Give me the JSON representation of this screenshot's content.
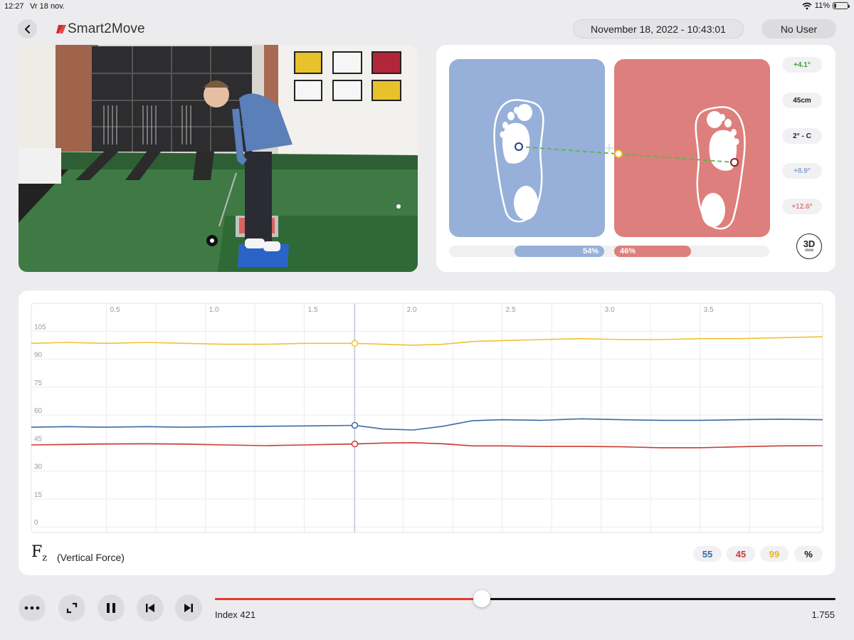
{
  "status": {
    "time": "12:27",
    "date": "Vr 18 nov.",
    "battery": "11%"
  },
  "header": {
    "brand": "Smart2Move",
    "datetime": "November 18, 2022 - 10:43:01",
    "user": "No User"
  },
  "colors": {
    "left": "#97b0d9",
    "right": "#dd7f7c",
    "total": "#f1c232",
    "blue_line": "#3a6aa5",
    "red_line": "#c93a33",
    "accent": "#e23b30"
  },
  "distribution": {
    "left": "54%",
    "right": "46%"
  },
  "metrics": [
    {
      "value": "+4.1°",
      "color": "#3f9a3f"
    },
    {
      "value": "45cm",
      "color": "#222222"
    },
    {
      "value": "2° - C",
      "color": "#222222"
    },
    {
      "value": "+8.9°",
      "color": "#8aa4d0"
    },
    {
      "value": "+12.6°",
      "color": "#dd7f7c"
    }
  ],
  "view_button": {
    "main": "3D",
    "sub": "view"
  },
  "chart_data": {
    "type": "line",
    "x_ticks": [
      "0.5",
      "1.0",
      "1.5",
      "2.0",
      "2.5",
      "3.0",
      "3.5"
    ],
    "y_ticks": [
      "0",
      "15",
      "30",
      "45",
      "60",
      "75",
      "90",
      "105"
    ],
    "xlim": [
      0.12,
      4.12
    ],
    "ylim": [
      -3,
      120
    ],
    "cursor_x": 1.755,
    "x": [
      0.12,
      0.3,
      0.5,
      0.7,
      0.9,
      1.1,
      1.3,
      1.5,
      1.755,
      1.9,
      2.05,
      2.2,
      2.35,
      2.5,
      2.7,
      2.9,
      3.1,
      3.3,
      3.5,
      3.7,
      3.9,
      4.12
    ],
    "series": [
      {
        "values": [
          98.5,
          99,
          98.5,
          99,
          98.5,
          98,
          98,
          98.5,
          98.5,
          98,
          97.5,
          98,
          99.5,
          100,
          100.5,
          101,
          100.5,
          100.5,
          101,
          101,
          101.5,
          102
        ]
      },
      {
        "values": [
          53.5,
          53.8,
          53.5,
          53.8,
          53.5,
          53.8,
          54,
          54.2,
          54.5,
          52.5,
          52,
          54,
          57,
          57.5,
          57.2,
          58,
          57.5,
          57.2,
          57.2,
          57.5,
          57.8,
          57.5
        ]
      },
      {
        "values": [
          44,
          44.2,
          44.5,
          44.6,
          44.4,
          44,
          43.6,
          44,
          44.5,
          45,
          45.2,
          44.6,
          43.5,
          43.5,
          43.2,
          43.2,
          43,
          42.5,
          42.5,
          43,
          43.5,
          43.6
        ]
      }
    ]
  },
  "chart_footer": {
    "symbol": "F",
    "subscript": "z",
    "label": "(Vertical Force)",
    "values": [
      "55",
      "45",
      "99",
      "%"
    ]
  },
  "playback": {
    "index_label": "Index 421",
    "time": "1.755",
    "progress": 0.43
  }
}
